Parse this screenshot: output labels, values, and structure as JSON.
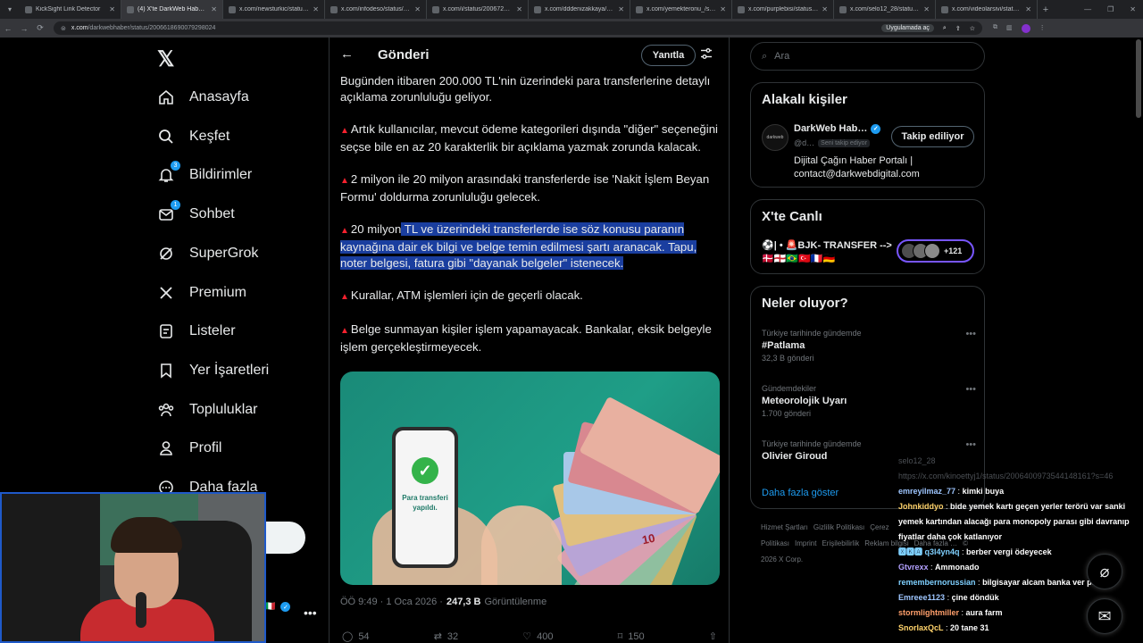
{
  "browser": {
    "tabs": [
      {
        "title": "KickSight Link Detector",
        "active": false
      },
      {
        "title": "(4) X'te DarkWeb Haber: \"Bug…",
        "active": true
      },
      {
        "title": "x.com/newsturkic/status/2006…",
        "active": false
      },
      {
        "title": "x.com/infodeso/status/20066…",
        "active": false
      },
      {
        "title": "x.com/i/status/200672711610…",
        "active": false
      },
      {
        "title": "x.com/dddenizakkaya/status/…",
        "active": false
      },
      {
        "title": "x.com/yemekteronu_/status/2…",
        "active": false
      },
      {
        "title": "x.com/purplebisi/status/2006…",
        "active": false
      },
      {
        "title": "x.com/selo12_28/status/2006…",
        "active": false
      },
      {
        "title": "x.com/videolarsivi/status/200…",
        "active": false
      }
    ],
    "url_host": "x.com",
    "url_path": "/darkwebhaber/status/2006618690079298024",
    "app_pill": "Uygulamada aç"
  },
  "nav": {
    "items": [
      {
        "label": "Anasayfa",
        "icon": "home-icon"
      },
      {
        "label": "Keşfet",
        "icon": "search-icon"
      },
      {
        "label": "Bildirimler",
        "icon": "bell-icon",
        "badge": "3"
      },
      {
        "label": "Sohbet",
        "icon": "mail-icon",
        "badge": "1"
      },
      {
        "label": "SuperGrok",
        "icon": "grok-icon"
      },
      {
        "label": "Premium",
        "icon": "x-premium-icon"
      },
      {
        "label": "Listeler",
        "icon": "list-icon"
      },
      {
        "label": "Yer İşaretleri",
        "icon": "bookmark-icon"
      },
      {
        "label": "Topluluklar",
        "icon": "communities-icon"
      },
      {
        "label": "Profil",
        "icon": "profile-icon"
      },
      {
        "label": "Daha fazla",
        "icon": "more-icon"
      }
    ],
    "post_button": "a"
  },
  "post": {
    "header_title": "Gönderi",
    "reply_button": "Yanıtla",
    "intro": "Bugünden itibaren 200.000 TL'nin üzerindeki para transferlerine detaylı açıklama zorunluluğu geliyor.",
    "bullet1": "Artık kullanıcılar, mevcut ödeme kategorileri dışında \"diğer\" seçeneğini seçse bile en az 20 karakterlik bir açıklama yazmak zorunda kalacak.",
    "bullet2": "2 milyon ile 20 milyon arasındaki transferlerde ise 'Nakit İşlem Beyan Formu' doldurma zorunluluğu gelecek.",
    "bullet3_pre": "20 milyon",
    "bullet3_highlight": " TL ve üzerindeki transferlerde ise söz konusu paranın kaynağına dair ek bilgi ve belge temin edilmesi şartı aranacak. Tapu, noter belgesi, fatura gibi \"dayanak belgeler\" istenecek.",
    "bullet4": "Kurallar, ATM işlemleri için de geçerli olacak.",
    "bullet5": "Belge sunmayan kişiler işlem yapamayacak. Bankalar, eksik belgeyle işlem gerçekleştirmeyecek.",
    "image_phone_text": "Para transferi yapıldı.",
    "image_bill_text": "10",
    "meta_time": "ÖÖ 9:49 · 1 Oca 2026 ·",
    "meta_views": "247,3 B",
    "meta_views_label": "Görüntülenme",
    "actions": {
      "replies": "54",
      "reposts": "32",
      "likes": "400",
      "bookmarks": "150"
    }
  },
  "right": {
    "search_placeholder": "Ara",
    "related_title": "Alakalı kişiler",
    "related": {
      "name": "DarkWeb Hab…",
      "handle": "@d…",
      "follows_you": "Seni takip ediyor",
      "follow_button": "Takip ediliyor",
      "bio": "Dijital Çağın Haber Portalı | contact@darkwebdigital.com",
      "avatar_text": "darkweb"
    },
    "live_title": "X'te Canlı",
    "live_item": "⚽| • 🚨BJK- TRANSFER -->🇩🇰🏴󠁧󠁢󠁥󠁮󠁧󠁿🇧🇷🇹🇷🇫🇷🇩🇪",
    "live_count": "+121",
    "trends_title": "Neler oluyor?",
    "trends": [
      {
        "context": "Türkiye tarihinde gündemde",
        "name": "#Patlama",
        "count": "32,3 B gönderi"
      },
      {
        "context": "Gündemdekiler",
        "name": "Meteorolojik Uyarı",
        "count": "1.700 gönderi"
      },
      {
        "context": "Türkiye tarihinde gündemde",
        "name": "Olivier Giroud",
        "count": ""
      }
    ],
    "show_more": "Daha fazla göster",
    "footer": [
      "Hizmet Şartları",
      "Gizlilik Politikası",
      "Çerez Politikası",
      "Imprint",
      "Erişilebilirlik",
      "Reklam bilgisi",
      "Daha fazla …",
      "© 2026 X Corp."
    ]
  },
  "chat": {
    "ghost1": "selo12_28",
    "ghost2": "https://x.com/kinoettyj1/status/2006400973544148161?s=46",
    "messages": [
      {
        "user": "emreyilmaz_77",
        "text": "kimki buya",
        "cls": "u1"
      },
      {
        "user": "Johnkiddyo",
        "text": "bide yemek kartı geçen yerler terörü var sanki yemek kartından alacağı para monopoly parası gibi davranıp fiyatlar daha çok katlanıyor",
        "cls": "u2"
      },
      {
        "user": "🆇🅺🅰 q3l4yn4q",
        "text": "berber vergi ödeyecek",
        "cls": "u3"
      },
      {
        "user": "Gtvrexx",
        "text": "Ammonado",
        "cls": "u4"
      },
      {
        "user": "remembernorussian",
        "text": "bilgisayar alcam banka ver parami",
        "cls": "u3"
      },
      {
        "user": "Emreee1123",
        "text": "çine döndük",
        "cls": "u1"
      },
      {
        "user": "stormlightmiller",
        "text": "aura farm",
        "cls": "u5"
      },
      {
        "user": "SnorlaxQcL",
        "text": "20 tane 31",
        "cls": "u2"
      }
    ]
  },
  "colors": {
    "accent": "#1d9bf0",
    "highlight": "#1a3e9f",
    "alert_triangle": "#f4212e"
  }
}
